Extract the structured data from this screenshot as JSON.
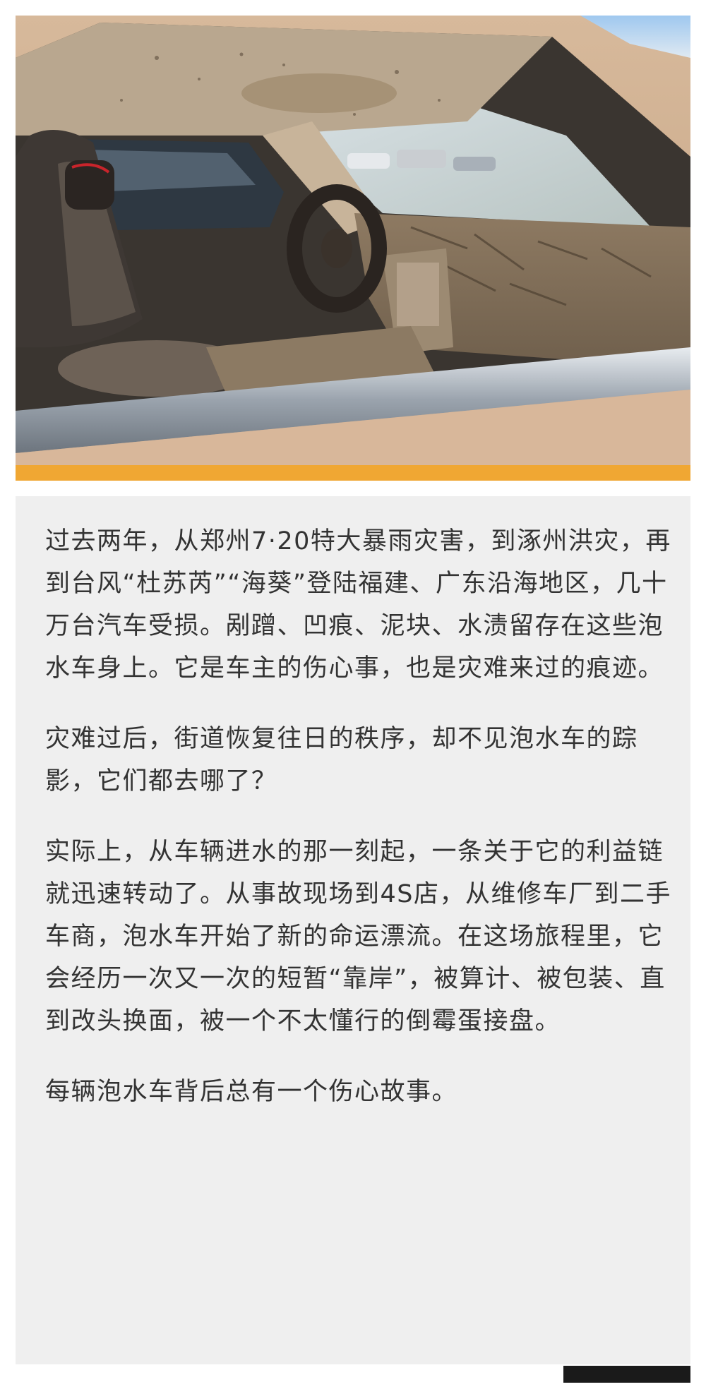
{
  "article": {
    "paragraphs": [
      "过去两年，从郑州7·20特大暴雨灾害，到涿州洪灾，再到台风“杜苏芮”“海葵”登陆福建、广东沿海地区，几十万台汽车受损。剐蹭、凹痕、泥块、水渍留存在这些泡水车身上。它是车主的伤心事，也是灾难来过的痕迹。",
      "灾难过后，街道恢复往日的秩序，却不见泡水车的踪影，它们都去哪了？",
      "实际上，从车辆进水的那一刻起，一条关于它的利益链就迅速转动了。从事故现场到4S店，从维修车厂到二手车商，泡水车开始了新的命运漂流。在这场旅程里，它会经历一次又一次的短暂“靠岸”，被算计、被包装、直到改头换面，被一个不太懂行的倒霉蛋接盘。",
      "每辆泡水车背后总有一个伤心故事。"
    ]
  },
  "colors": {
    "accent": "#f0a733",
    "card_background": "#efefef",
    "text": "#333333",
    "footer_bar": "#1a1a1a"
  }
}
